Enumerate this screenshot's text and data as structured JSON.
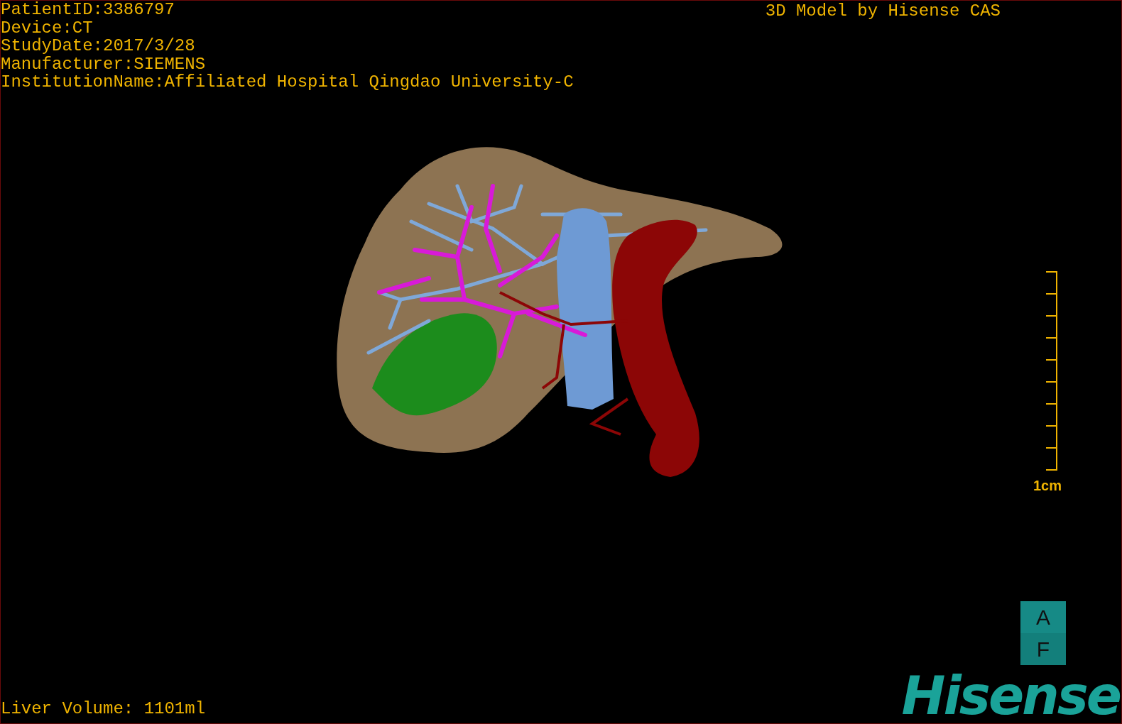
{
  "info_lines": [
    "PatientID:3386797",
    "Device:CT",
    "StudyDate:2017/3/28",
    "Manufacturer:SIEMENS",
    "InstitutionName:Affiliated Hospital Qingdao University-C"
  ],
  "title": "3D Model by Hisense CAS",
  "scale_bar": {
    "label": "1cm"
  },
  "orientation_cube": {
    "top": "A",
    "bottom": "F"
  },
  "logo": "Hisense",
  "liver_volume": "Liver Volume: 1101ml"
}
